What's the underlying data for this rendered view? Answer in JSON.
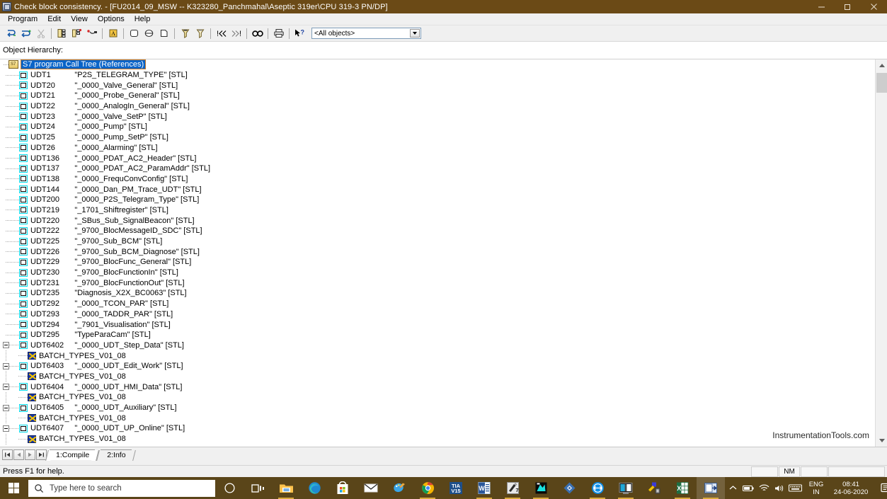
{
  "window": {
    "title": "Check block consistency. - [FU2014_09_MSW -- K323280_Panchmahal\\Aseptic 319er\\CPU 319-3 PN/DP]",
    "app_icon": "s7-program-icon",
    "minimize": "—",
    "maximize": "❐",
    "close": "✕"
  },
  "menu": {
    "items": [
      {
        "label": "Program"
      },
      {
        "label": "Edit"
      },
      {
        "label": "View"
      },
      {
        "label": "Options"
      },
      {
        "label": "Help"
      }
    ]
  },
  "toolbar": {
    "buttons": [
      {
        "name": "recompile-icon",
        "title": "Recompile"
      },
      {
        "name": "compile-all-icon",
        "title": "Compile all"
      },
      {
        "name": "cut-icon",
        "title": "Cut"
      },
      {
        "name": "hierarchy-icon",
        "title": "Object hierarchy"
      },
      {
        "name": "dependency-icon",
        "title": "Dependency tree"
      },
      {
        "name": "references-icon",
        "title": "References"
      },
      {
        "name": "properties-icon",
        "title": "Properties"
      },
      {
        "name": "block-icon",
        "title": "Block"
      },
      {
        "name": "symbol-icon",
        "title": "Symbol"
      },
      {
        "name": "source-icon",
        "title": "Source"
      },
      {
        "name": "filter-icon",
        "title": "Filter"
      },
      {
        "name": "filter-clear-icon",
        "title": "Clear filter"
      },
      {
        "name": "prev-error-icon",
        "title": "Previous error"
      },
      {
        "name": "next-error-icon",
        "title": "Next error"
      },
      {
        "name": "find-icon",
        "title": "Find"
      },
      {
        "name": "print-icon",
        "title": "Print"
      },
      {
        "name": "help-pointer-icon",
        "title": "Context help"
      }
    ],
    "filter_combo": {
      "value": "<All objects>",
      "name": "object-filter-combo"
    }
  },
  "pane": {
    "hierarchy_label": "Object Hierarchy:"
  },
  "tree": {
    "root": {
      "label": "S7 program Call Tree (References)",
      "icon": "s7-program-icon",
      "selected": true
    },
    "rows": [
      {
        "name": "UDT1",
        "desc": "\"P2S_TELEGRAM_TYPE\"  [STL]",
        "type": "udt",
        "expander": "none"
      },
      {
        "name": "UDT20",
        "desc": "\"_0000_Valve_General\"  [STL]",
        "type": "udt",
        "expander": "none"
      },
      {
        "name": "UDT21",
        "desc": "\"_0000_Probe_General\"  [STL]",
        "type": "udt",
        "expander": "none"
      },
      {
        "name": "UDT22",
        "desc": "\"_0000_AnalogIn_General\"  [STL]",
        "type": "udt",
        "expander": "none"
      },
      {
        "name": "UDT23",
        "desc": "\"_0000_Valve_SetP\"  [STL]",
        "type": "udt",
        "expander": "none"
      },
      {
        "name": "UDT24",
        "desc": "\"_0000_Pump\"  [STL]",
        "type": "udt",
        "expander": "none"
      },
      {
        "name": "UDT25",
        "desc": "\"_0000_Pump_SetP\"  [STL]",
        "type": "udt",
        "expander": "none"
      },
      {
        "name": "UDT26",
        "desc": "\"_0000_Alarming\"  [STL]",
        "type": "udt",
        "expander": "none"
      },
      {
        "name": "UDT136",
        "desc": "\"_0000_PDAT_AC2_Header\"  [STL]",
        "type": "udt",
        "expander": "none"
      },
      {
        "name": "UDT137",
        "desc": "\"_0000_PDAT_AC2_ParamAddr\"  [STL]",
        "type": "udt",
        "expander": "none"
      },
      {
        "name": "UDT138",
        "desc": "\"_0000_FrequConvConfig\"  [STL]",
        "type": "udt",
        "expander": "none"
      },
      {
        "name": "UDT144",
        "desc": "\"_0000_Dan_PM_Trace_UDT\"  [STL]",
        "type": "udt",
        "expander": "none"
      },
      {
        "name": "UDT200",
        "desc": "\"_0000_P2S_Telegram_Type\"  [STL]",
        "type": "udt",
        "expander": "none"
      },
      {
        "name": "UDT219",
        "desc": "\"_1701_Shiftregister\"  [STL]",
        "type": "udt",
        "expander": "none"
      },
      {
        "name": "UDT220",
        "desc": "\"_SBus_Sub_SignalBeacon\"  [STL]",
        "type": "udt",
        "expander": "none"
      },
      {
        "name": "UDT222",
        "desc": "\"_9700_BlocMessageID_SDC\"  [STL]",
        "type": "udt",
        "expander": "none"
      },
      {
        "name": "UDT225",
        "desc": "\"_9700_Sub_BCM\"  [STL]",
        "type": "udt",
        "expander": "none"
      },
      {
        "name": "UDT226",
        "desc": "\"_9700_Sub_BCM_Diagnose\"  [STL]",
        "type": "udt",
        "expander": "none"
      },
      {
        "name": "UDT229",
        "desc": "\"_9700_BlocFunc_General\"  [STL]",
        "type": "udt",
        "expander": "none"
      },
      {
        "name": "UDT230",
        "desc": "\"_9700_BlocFunctionIn\"  [STL]",
        "type": "udt",
        "expander": "none"
      },
      {
        "name": "UDT231",
        "desc": "\"_9700_BlocFunctionOut\"  [STL]",
        "type": "udt",
        "expander": "none"
      },
      {
        "name": "UDT235",
        "desc": "\"Diagnosis_X2X_BC0063\"  [STL]",
        "type": "udt",
        "expander": "none"
      },
      {
        "name": "UDT292",
        "desc": "\"_0000_TCON_PAR\"  [STL]",
        "type": "udt",
        "expander": "none"
      },
      {
        "name": "UDT293",
        "desc": "\"_0000_TADDR_PAR\"  [STL]",
        "type": "udt",
        "expander": "none"
      },
      {
        "name": "UDT294",
        "desc": "\"_7901_Visualisation\"  [STL]",
        "type": "udt",
        "expander": "none"
      },
      {
        "name": "UDT295",
        "desc": "\"TypeParaCam\"  [STL]",
        "type": "udt",
        "expander": "none"
      },
      {
        "name": "UDT6402",
        "desc": "\"_0000_UDT_Step_Data\"  [STL]",
        "type": "udt",
        "expander": "minus"
      },
      {
        "name": "BATCH_TYPES_V01_08",
        "desc": "",
        "type": "source",
        "child": true
      },
      {
        "name": "UDT6403",
        "desc": "\"_0000_UDT_Edit_Work\"  [STL]",
        "type": "udt",
        "expander": "minus"
      },
      {
        "name": "BATCH_TYPES_V01_08",
        "desc": "",
        "type": "source",
        "child": true
      },
      {
        "name": "UDT6404",
        "desc": "\"_0000_UDT_HMI_Data\"  [STL]",
        "type": "udt",
        "expander": "minus"
      },
      {
        "name": "BATCH_TYPES_V01_08",
        "desc": "",
        "type": "source",
        "child": true
      },
      {
        "name": "UDT6405",
        "desc": "\"_0000_UDT_Auxiliary\"  [STL]",
        "type": "udt",
        "expander": "minus"
      },
      {
        "name": "BATCH_TYPES_V01_08",
        "desc": "",
        "type": "source",
        "child": true
      },
      {
        "name": "UDT6407",
        "desc": "\"_0000_UDT_UP_Online\"  [STL]",
        "type": "udt",
        "expander": "minus"
      },
      {
        "name": "BATCH_TYPES_V01_08",
        "desc": "",
        "type": "source",
        "child": true
      }
    ]
  },
  "watermark": {
    "text": "InstrumentationTools.com"
  },
  "tabstrip": {
    "nav": [
      {
        "name": "first-tab-button",
        "glyph": "|◀"
      },
      {
        "name": "previous-tab-button",
        "glyph": "◀"
      },
      {
        "name": "next-tab-button",
        "glyph": "▶"
      },
      {
        "name": "last-tab-button",
        "glyph": "▶|"
      }
    ],
    "tabs": [
      {
        "label": "1:Compile",
        "active": true
      },
      {
        "label": "2:Info",
        "active": false
      }
    ]
  },
  "statusbar": {
    "message": "Press F1 for help.",
    "cells": [
      "",
      "NM",
      "",
      ""
    ]
  },
  "taskbar": {
    "start": {
      "name": "start-button"
    },
    "search": {
      "placeholder": "Type here to search"
    },
    "icons": [
      {
        "name": "cortana-icon",
        "label": "Cortana",
        "open": false
      },
      {
        "name": "task-view-icon",
        "label": "Task View",
        "open": false
      },
      {
        "name": "file-explorer-icon",
        "label": "File Explorer",
        "open": true
      },
      {
        "name": "microsoft-edge-icon",
        "label": "Microsoft Edge",
        "open": false
      },
      {
        "name": "microsoft-store-icon",
        "label": "Microsoft Store",
        "open": false
      },
      {
        "name": "mail-icon",
        "label": "Mail",
        "open": false
      },
      {
        "name": "paint-3d-icon",
        "label": "Paint 3D",
        "open": false
      },
      {
        "name": "google-chrome-icon",
        "label": "Google Chrome",
        "open": true
      },
      {
        "name": "tia-portal-v15-icon",
        "label": "TIA V15",
        "open": false,
        "text": "TIA\nV15"
      },
      {
        "name": "microsoft-word-icon",
        "label": "Word",
        "open": true
      },
      {
        "name": "simatic-manager-icon",
        "label": "SIMATIC Manager",
        "open": true
      },
      {
        "name": "wincc-flexible-icon",
        "label": "WinCC flexible",
        "open": true
      },
      {
        "name": "anydesk-icon",
        "label": "AnyDesk",
        "open": false
      },
      {
        "name": "teamviewer-icon",
        "label": "TeamViewer",
        "open": true
      },
      {
        "name": "remote-desktop-icon",
        "label": "Remote Desktop",
        "open": true
      },
      {
        "name": "plc-tool-icon",
        "label": "PLC Tool",
        "open": false
      },
      {
        "name": "microsoft-excel-icon",
        "label": "Excel",
        "open": true
      },
      {
        "name": "block-consistency-icon",
        "label": "Check block consistency",
        "open": true,
        "active": true
      }
    ],
    "tray": {
      "chevron": {
        "name": "show-hidden-icons"
      },
      "battery": {
        "name": "battery-icon"
      },
      "network": {
        "name": "wifi-icon"
      },
      "volume": {
        "name": "volume-icon"
      },
      "keyboard": {
        "name": "keyboard-icon"
      },
      "language_top": "ENG",
      "language_bottom": "IN",
      "time": "08:41",
      "date": "24-06-2020",
      "action_center": {
        "name": "action-center-icon"
      }
    }
  }
}
